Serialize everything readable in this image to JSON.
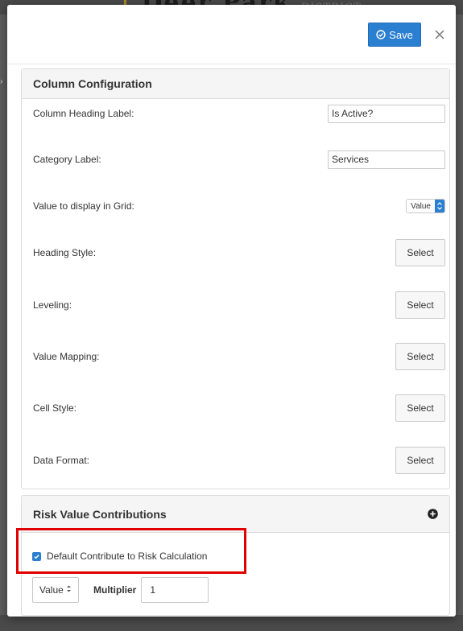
{
  "header": {
    "save_label": "Save",
    "close_icon": "close-icon",
    "save_icon": "check-circle-icon"
  },
  "background": {
    "logo_text_main": "Deer Park",
    "logo_text_small": "DISTRICT"
  },
  "column_configuration": {
    "title": "Column Configuration",
    "heading_label": {
      "label": "Column Heading Label:",
      "value": "Is Active?"
    },
    "category_label": {
      "label": "Category Label:",
      "value": "Services"
    },
    "grid_value": {
      "label": "Value to display in Grid:",
      "selected": "Value"
    },
    "heading_style": {
      "label": "Heading Style:",
      "button": "Select"
    },
    "leveling": {
      "label": "Leveling:",
      "button": "Select"
    },
    "value_mapping": {
      "label": "Value Mapping:",
      "button": "Select"
    },
    "cell_style": {
      "label": "Cell Style:",
      "button": "Select"
    },
    "data_format": {
      "label": "Data Format:",
      "button": "Select"
    }
  },
  "risk_value_contributions": {
    "title": "Risk Value Contributions",
    "add_icon": "plus-circle-icon",
    "default_contribute_label": "Default Contribute to Risk Calculation",
    "default_contribute_checked": true,
    "value_select": "Value",
    "multiplier_label": "Multiplier",
    "multiplier_value": "1"
  },
  "colors": {
    "accent": "#2b7fd0",
    "highlight": "#e00000",
    "panel_header": "#f5f5f5"
  }
}
